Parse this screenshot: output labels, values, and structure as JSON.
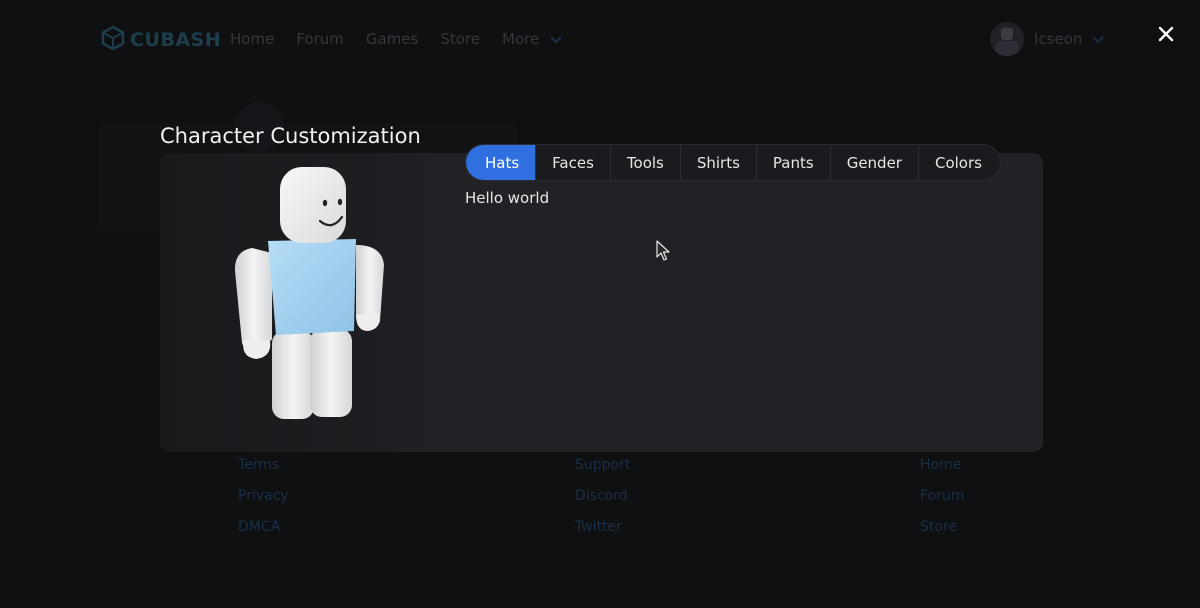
{
  "navbar": {
    "brand": "CUBASH",
    "links": [
      "Home",
      "Forum",
      "Games",
      "Store",
      "More"
    ],
    "username": "Icseon"
  },
  "footer": {
    "col1": [
      "Terms",
      "Privacy",
      "DMCA"
    ],
    "col2": [
      "Support",
      "Discord",
      "Twitter"
    ],
    "col3": [
      "Home",
      "Forum",
      "Store"
    ]
  },
  "modal": {
    "title": "Character Customization",
    "tabs": [
      "Hats",
      "Faces",
      "Tools",
      "Shirts",
      "Pants",
      "Gender",
      "Colors"
    ],
    "active_tab": "Hats",
    "content": "Hello world"
  },
  "colors": {
    "accent": "#2f6fe0",
    "modal_bg": "#212226",
    "shirt": "#a6d3f2"
  },
  "icons": [
    "cube-logo-icon",
    "chevron-down-icon",
    "close-icon",
    "mouse-cursor-icon"
  ]
}
